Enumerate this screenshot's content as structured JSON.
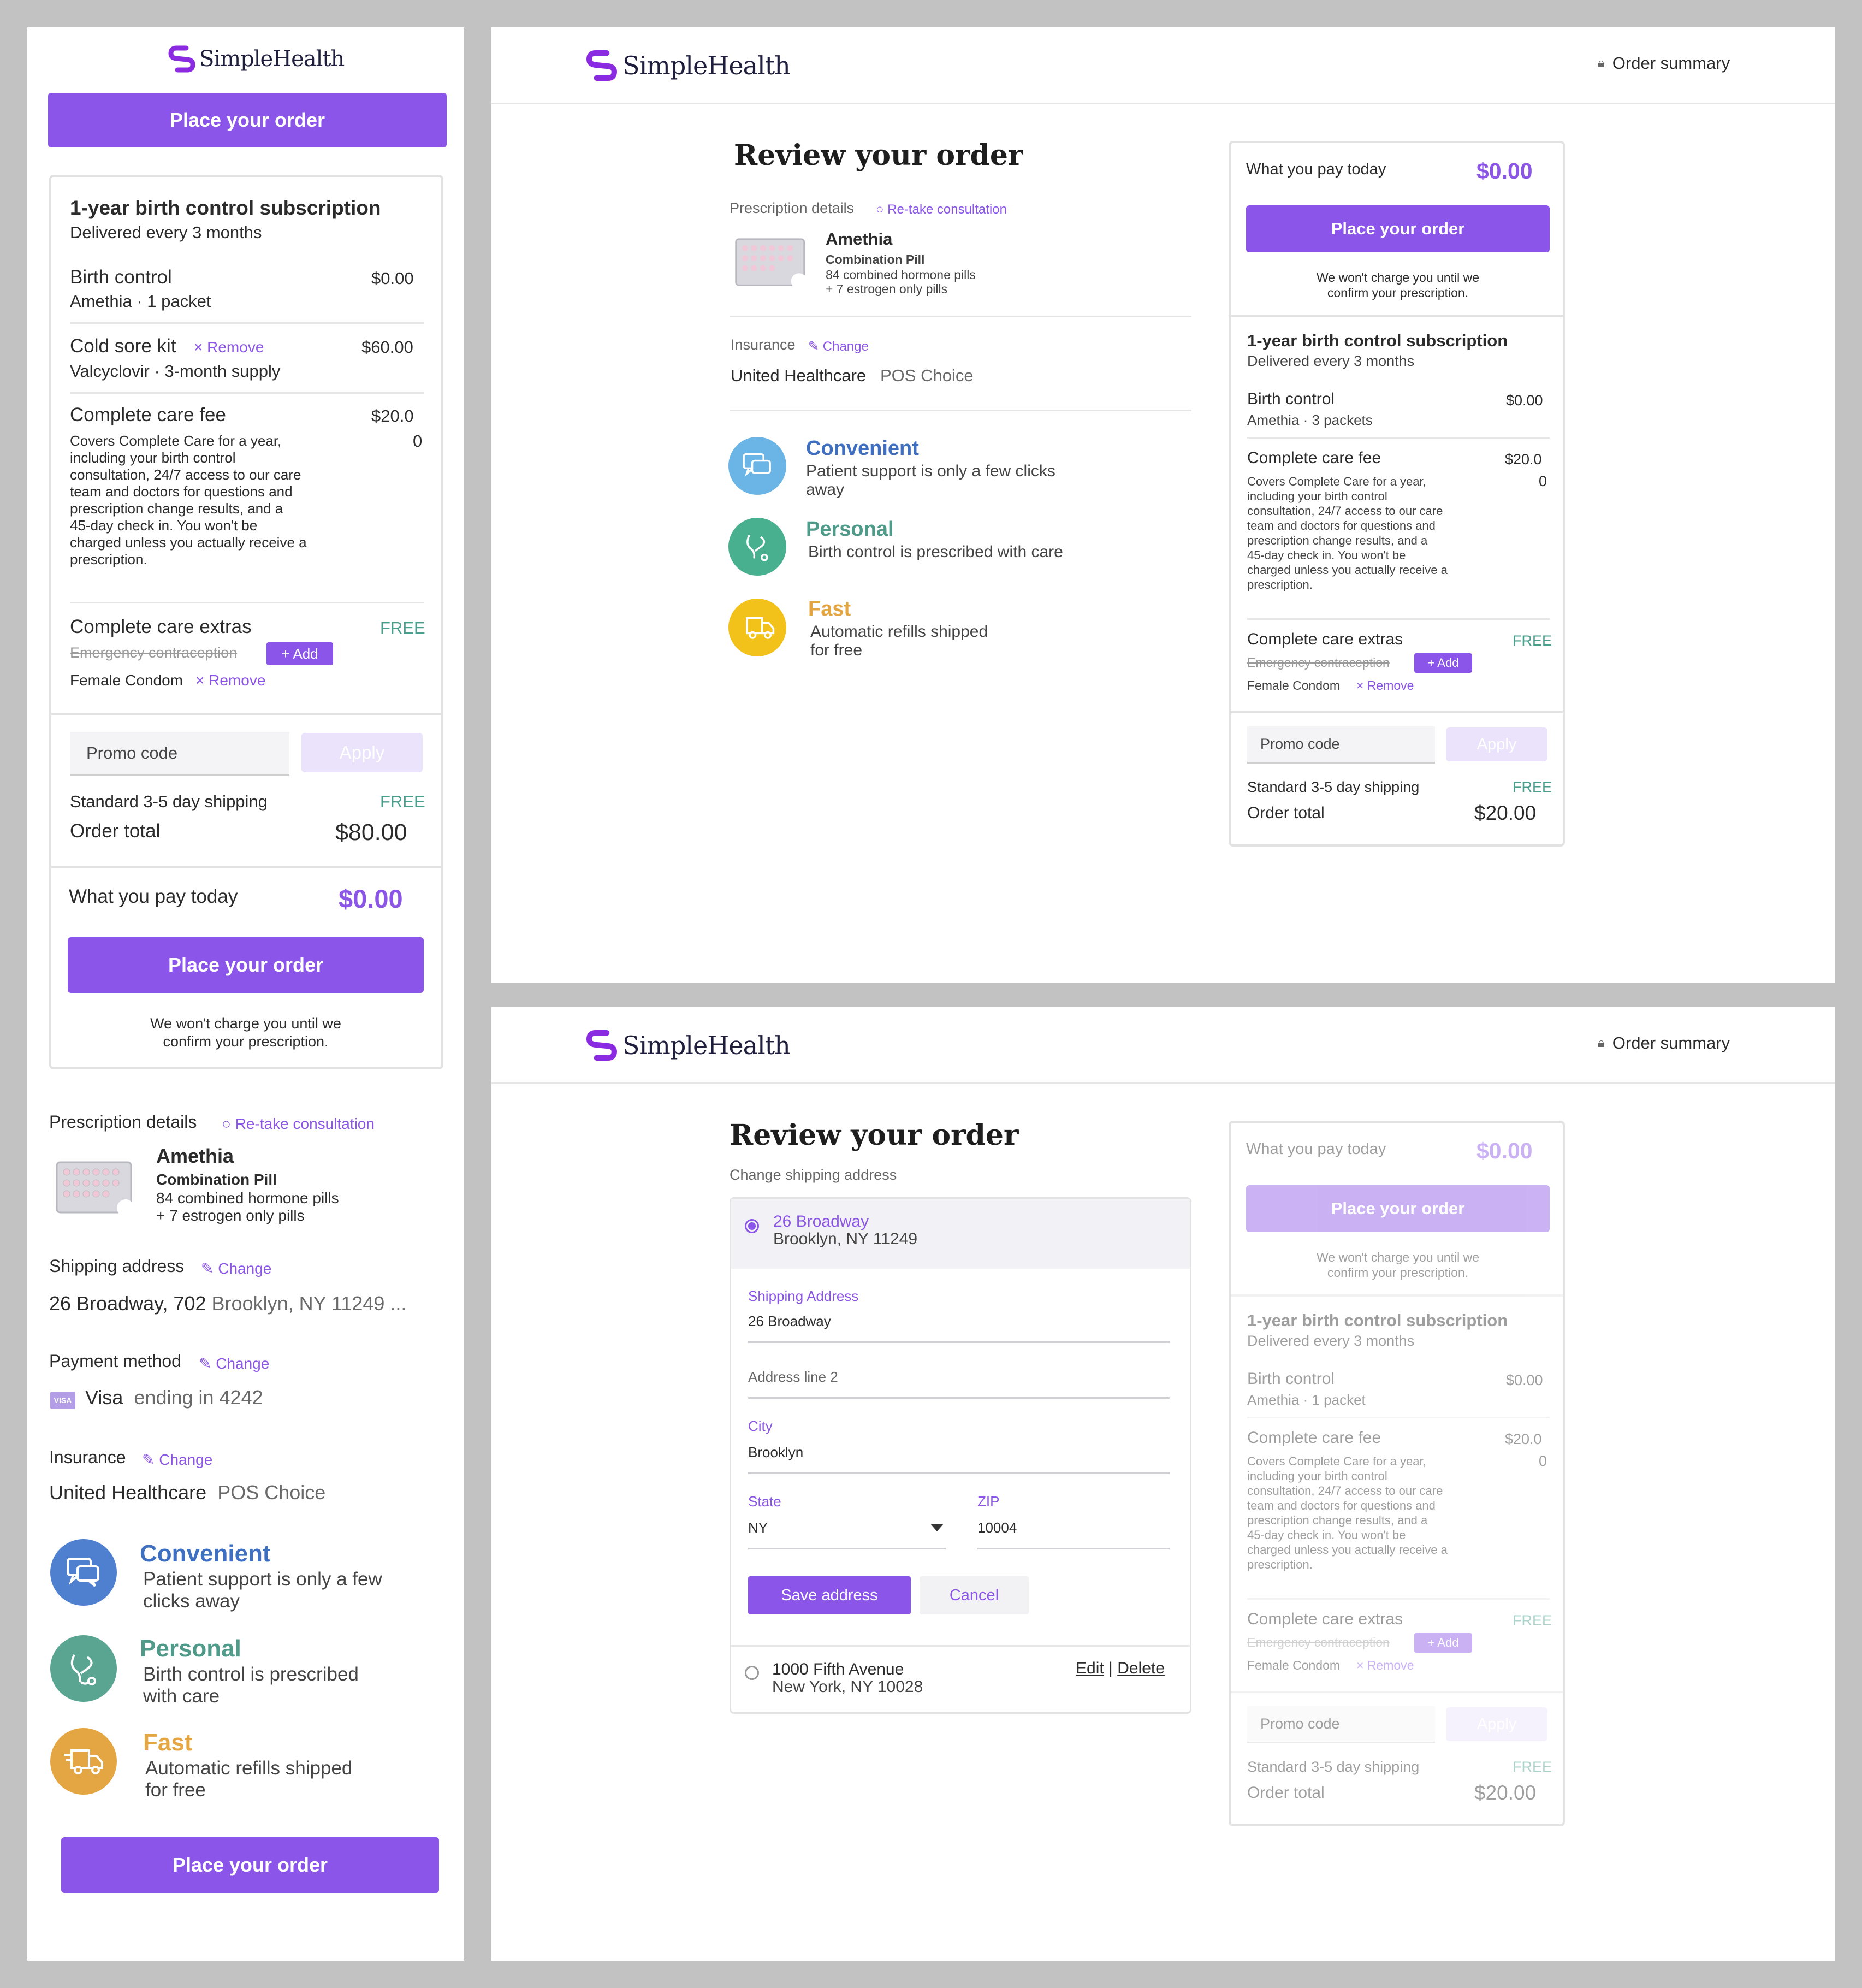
{
  "brand": {
    "name": "SimpleHealth",
    "accent": "#8a55e8",
    "green": "#4a9e8c"
  },
  "common": {
    "place_order": "Place your order",
    "order_summary": "Order summary",
    "review_title": "Review your order",
    "pay_today_label": "What you pay today",
    "pay_today_value": "$0.00",
    "no_charge_note_1": "We won't charge you until we",
    "no_charge_note_2": "confirm your prescription.",
    "subscription_title": "1-year birth control subscription",
    "subscription_sub": "Delivered every 3 months",
    "birth_control": "Birth control",
    "birth_control_price": "$0.00",
    "care_fee": "Complete care fee",
    "care_fee_price_1": "$20.0",
    "care_fee_price_2": "0",
    "care_fee_desc_1": "Covers Complete Care for a year,",
    "care_fee_desc_2": "including your birth control",
    "care_fee_desc_3": "consultation, 24/7 access to our care",
    "care_fee_desc_4": "team and doctors for questions and",
    "care_fee_desc_5": "prescription change results, and a",
    "care_fee_desc_6": "45-day check in. You won't be",
    "care_fee_desc_7": "charged unless you actually receive a",
    "care_fee_desc_8": "prescription.",
    "extras": "Complete care extras",
    "free": "FREE",
    "emergency": "Emergency contraception",
    "add": "+ Add",
    "female_condom": "Female Condom",
    "remove": "× Remove",
    "promo_placeholder": "Promo code",
    "apply": "Apply",
    "shipping": "Standard 3-5 day shipping",
    "order_total": "Order total",
    "prescription_details": "Prescription details",
    "retake": "○ Re-take consultation",
    "med_name": "Amethia",
    "med_type": "Combination Pill",
    "med_line1": "84 combined hormone pills",
    "med_line2": "+ 7 estrogen only pills",
    "insurance": "Insurance",
    "change": "✎ Change",
    "insurer": "United Healthcare",
    "plan": "POS Choice",
    "convenient": "Convenient",
    "personal": "Personal",
    "fast": "Fast"
  },
  "mobile": {
    "amethia_qty": "Amethia · 1 packet",
    "cold_sore": "Cold sore kit",
    "cold_sore_price": "$60.00",
    "valcyclovir": "Valcyclovir · 3-month supply",
    "total": "$80.00",
    "shipping_label": "Shipping address",
    "address_bold": "26 Broadway, 702",
    "address_rest": "Brooklyn, NY 11249 ...",
    "payment_label": "Payment method",
    "visa": "Visa",
    "visa_badge": "VISA",
    "visa_ending": "ending in 4242",
    "convenient_1": "Patient support is only a few",
    "convenient_2": "clicks away",
    "personal_1": "Birth control is prescribed",
    "personal_2": "with care",
    "fast_1": "Automatic refills shipped",
    "fast_2": "for free"
  },
  "desktop1": {
    "amethia_qty": "Amethia · 3 packets",
    "total": "$20.00",
    "convenient_1": "Patient support is only a few clicks",
    "convenient_2": "away",
    "personal_1": "Birth control is prescribed with care",
    "fast_1": "Automatic refills shipped",
    "fast_2": "for free"
  },
  "desktop2": {
    "amethia_qty": "Amethia · 1 packet",
    "total": "$20.00",
    "change_address": "Change shipping address",
    "addr1_line1": "26 Broadway",
    "addr1_line2": "Brooklyn, NY 11249",
    "shipping_address_label": "Shipping Address",
    "shipping_address_value": "26 Broadway",
    "address_line2_placeholder": "Address line 2",
    "city_label": "City",
    "city_value": "Brooklyn",
    "state_label": "State",
    "state_value": "NY",
    "zip_label": "ZIP",
    "zip_value": "10004",
    "save_address": "Save address",
    "cancel": "Cancel",
    "addr2_line1": "1000 Fifth Avenue",
    "addr2_line2": "New York, NY 10028",
    "edit": "Edit",
    "separator": "|",
    "delete": "Delete"
  }
}
